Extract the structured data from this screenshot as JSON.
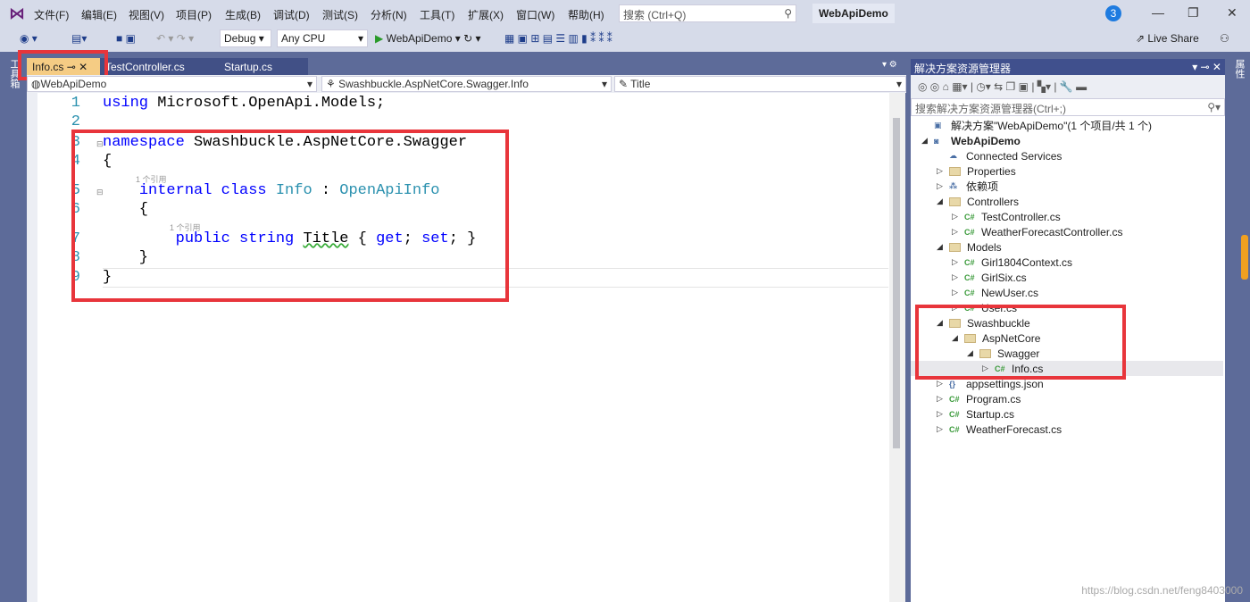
{
  "app": {
    "title": "WebApiDemo",
    "notifications": "3",
    "search_placeholder": "搜索 (Ctrl+Q)"
  },
  "menu": [
    "文件(F)",
    "编辑(E)",
    "视图(V)",
    "项目(P)",
    "生成(B)",
    "调试(D)",
    "测试(S)",
    "分析(N)",
    "工具(T)",
    "扩展(X)",
    "窗口(W)",
    "帮助(H)"
  ],
  "toolbar": {
    "config": "Debug",
    "platform": "Any CPU",
    "run_target": "WebApiDemo",
    "live_share": "Live Share"
  },
  "left_strip": "工具箱",
  "right_strip": "属性",
  "tabs": [
    {
      "label": "Info.cs",
      "active": true
    },
    {
      "label": "TestController.cs"
    },
    {
      "label": "Startup.cs"
    }
  ],
  "nav": {
    "project": "WebApiDemo",
    "type": "Swashbuckle.AspNetCore.Swagger.Info",
    "member": "Title"
  },
  "code": {
    "line_numbers": [
      "1",
      "2",
      "3",
      "4",
      "5",
      "6",
      "7",
      "8",
      "9"
    ],
    "lens": "1 个引用"
  },
  "solution_explorer": {
    "title": "解决方案资源管理器",
    "search_placeholder": "搜索解决方案资源管理器(Ctrl+;)",
    "items": [
      {
        "label": "解决方案\"WebApiDemo\"(1 个项目/共 1 个)",
        "type": "solution"
      },
      {
        "label": "WebApiDemo",
        "type": "project"
      },
      {
        "label": "Connected Services",
        "type": "service"
      },
      {
        "label": "Properties",
        "type": "folder"
      },
      {
        "label": "依赖项",
        "type": "deps"
      },
      {
        "label": "Controllers",
        "type": "folder"
      },
      {
        "label": "TestController.cs",
        "type": "cs"
      },
      {
        "label": "WeatherForecastController.cs",
        "type": "cs"
      },
      {
        "label": "Models",
        "type": "folder"
      },
      {
        "label": "Girl1804Context.cs",
        "type": "cs"
      },
      {
        "label": "GirlSix.cs",
        "type": "cs"
      },
      {
        "label": "NewUser.cs",
        "type": "cs"
      },
      {
        "label": "User.cs",
        "type": "cs"
      },
      {
        "label": "Swashbuckle",
        "type": "folder"
      },
      {
        "label": "AspNetCore",
        "type": "folder"
      },
      {
        "label": "Swagger",
        "type": "folder"
      },
      {
        "label": "Info.cs",
        "type": "cs",
        "selected": true
      },
      {
        "label": "appsettings.json",
        "type": "json"
      },
      {
        "label": "Program.cs",
        "type": "cs"
      },
      {
        "label": "Startup.cs",
        "type": "cs"
      },
      {
        "label": "WeatherForecast.cs",
        "type": "cs"
      }
    ]
  },
  "watermark": "https://blog.csdn.net/feng8403000",
  "colors": {
    "accent": "#5d6b99",
    "highlight_box": "#e8353b",
    "active_tab": "#f5cc84"
  }
}
